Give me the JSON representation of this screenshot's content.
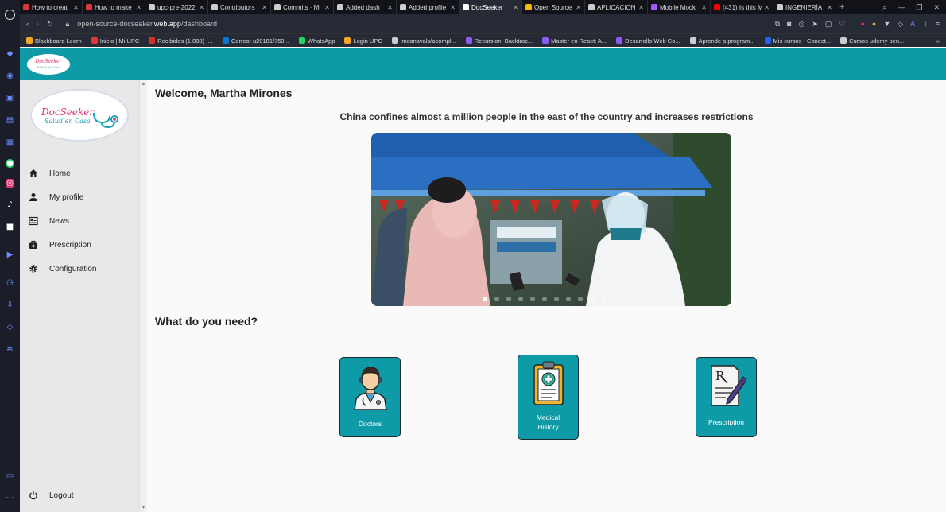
{
  "browser": {
    "tabs": [
      {
        "title": "How to creat",
        "color": "#e0353c"
      },
      {
        "title": "How to make",
        "color": "#e0353c"
      },
      {
        "title": "upc-pre-2022",
        "color": "#cccccc"
      },
      {
        "title": "Contributors",
        "color": "#cccccc"
      },
      {
        "title": "Commits · Mi",
        "color": "#cccccc"
      },
      {
        "title": "Added dash",
        "color": "#cccccc"
      },
      {
        "title": "Added profile",
        "color": "#cccccc"
      },
      {
        "title": "DocSeeker",
        "color": "#ffffff"
      },
      {
        "title": "Open Source",
        "color": "#f5b700"
      },
      {
        "title": "APLICACION",
        "color": "#cccccc"
      },
      {
        "title": "Mobile Mock",
        "color": "#a259ff"
      },
      {
        "title": "(431) Is this M",
        "color": "#ff0000"
      },
      {
        "title": "INGENIERÍA",
        "color": "#cccccc"
      }
    ],
    "url_prefix": "open-source-docseeker.",
    "url_domain": "web.app",
    "url_path": "/dashboard",
    "bookmarks": [
      {
        "label": "Blackboard Learn",
        "color": "#f5a623"
      },
      {
        "label": "Inicio | Mi UPC",
        "color": "#e0353c"
      },
      {
        "label": "Recibidos (1.888) -...",
        "color": "#d93025"
      },
      {
        "label": "Correo: u20181f759...",
        "color": "#0078d4"
      },
      {
        "label": "WhatsApp",
        "color": "#25d366"
      },
      {
        "label": "Login UPC",
        "color": "#f5a623"
      },
      {
        "label": "lmcanavals/acompl...",
        "color": "#cccccc"
      },
      {
        "label": "Recursion, Backtrac...",
        "color": "#8b5cf6"
      },
      {
        "label": "Master en React: A...",
        "color": "#8b5cf6"
      },
      {
        "label": "Desarrollo Web Co...",
        "color": "#8b5cf6"
      },
      {
        "label": "Aprende a program...",
        "color": "#cccccc"
      },
      {
        "label": "Mis cursos - Conect...",
        "color": "#2563eb"
      },
      {
        "label": "Cursos udemy pen...",
        "color": "#cccccc"
      }
    ]
  },
  "brand": {
    "name_part1": "Doc",
    "name_part2": "Seeker",
    "tagline": "Salud en Casa",
    "header_color": "#0e9aa7"
  },
  "sidebar": {
    "items": [
      {
        "label": "Home",
        "icon": "home-icon"
      },
      {
        "label": "My profile",
        "icon": "person-icon"
      },
      {
        "label": "News",
        "icon": "news-icon"
      },
      {
        "label": "Prescription",
        "icon": "medical-bag-icon"
      },
      {
        "label": "Configuration",
        "icon": "gear-icon"
      }
    ],
    "logout_label": "Logout"
  },
  "main": {
    "welcome": "Welcome, Martha Mirones",
    "news_headline": "China confines almost a million people in the east of the country and increases restrictions",
    "carousel_slides": 12,
    "carousel_active": 1,
    "section_title": "What do you need?",
    "cards": [
      {
        "label": "Doctors",
        "icon": "doctor-icon"
      },
      {
        "label": "Medical History",
        "icon": "medical-history-icon"
      },
      {
        "label": "Prescription",
        "icon": "prescription-icon"
      }
    ]
  }
}
